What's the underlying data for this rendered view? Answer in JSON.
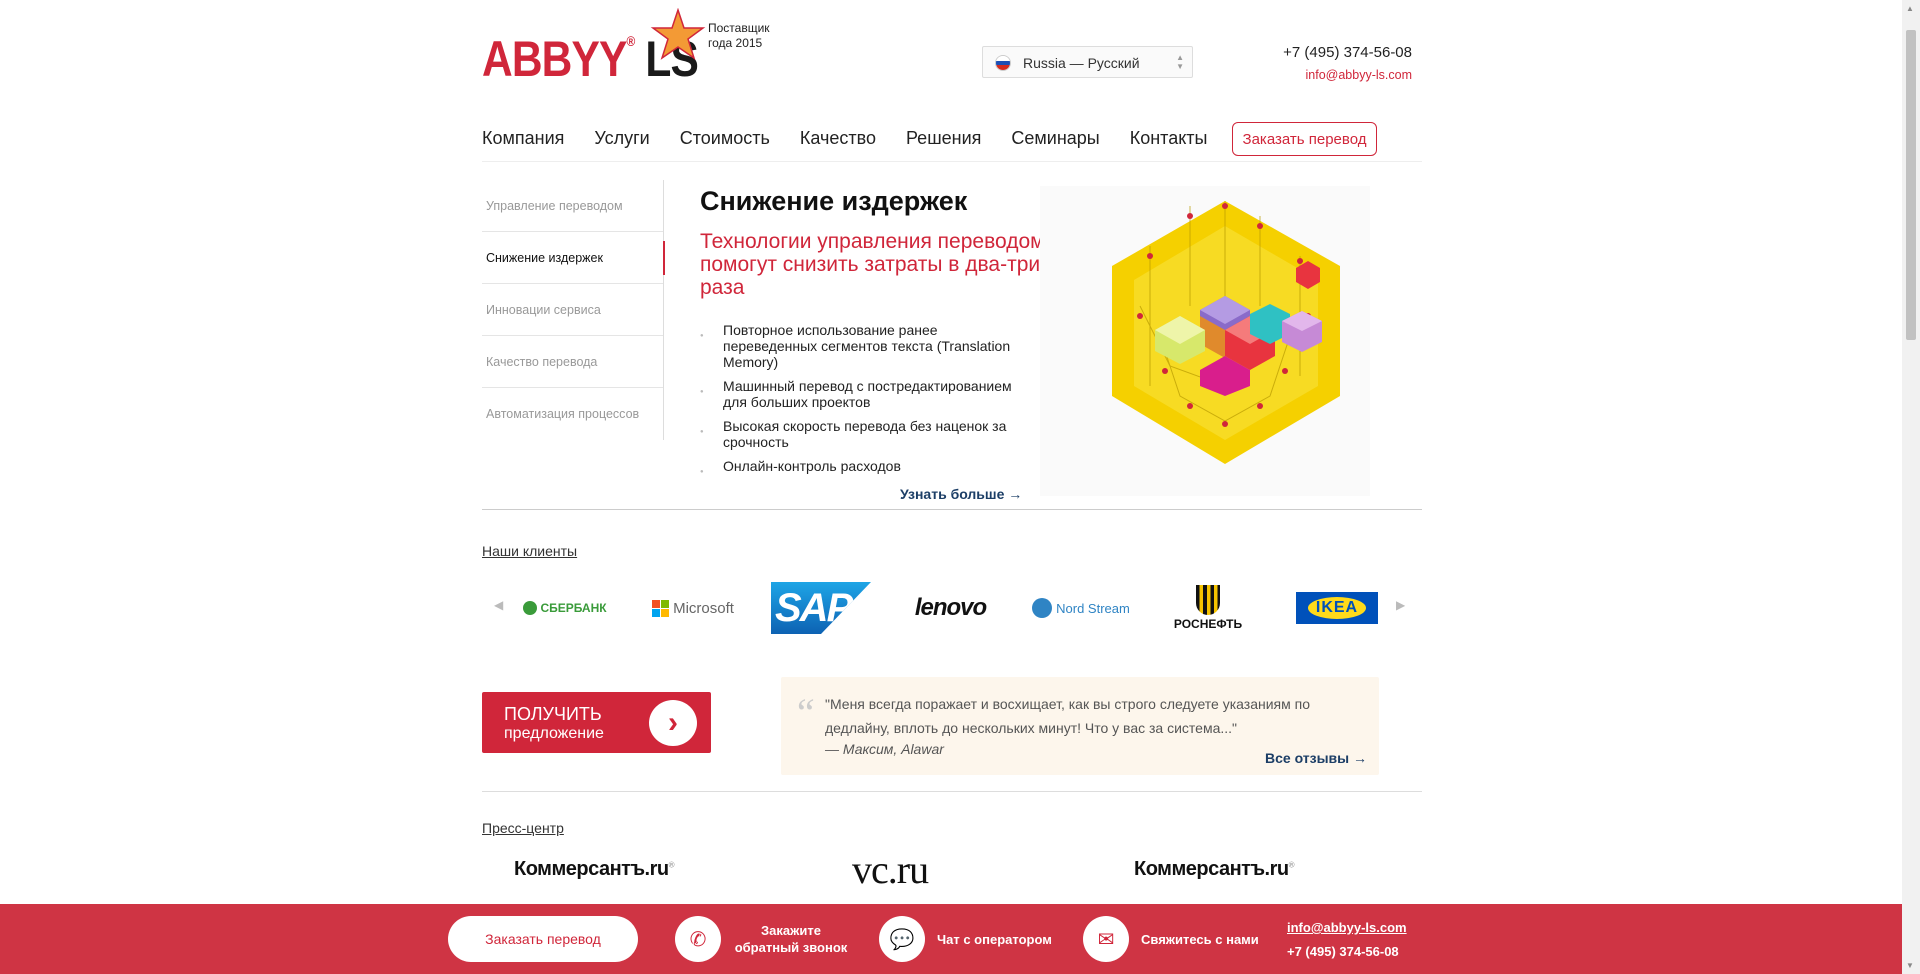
{
  "header": {
    "logo_abbyy": "ABBYY",
    "logo_ls": "LS",
    "award": [
      "Поставщик",
      "года 2015"
    ],
    "language": "Russia — Русский",
    "phone": "+7 (495) 374-56-08",
    "email": "info@abbyy-ls.com"
  },
  "nav": {
    "items": [
      "Компания",
      "Услуги",
      "Стоимость",
      "Качество",
      "Решения",
      "Семинары",
      "Контакты"
    ],
    "order_button": "Заказать перевод"
  },
  "side_menu": {
    "items": [
      "Управление переводом",
      "Снижение издержек",
      "Инновации сервиса",
      "Качество перевода",
      "Автоматизация процессов"
    ],
    "active_index": 1
  },
  "main": {
    "title": "Снижение издержек",
    "subtitle": "Технологии управления переводом помогут снизить затраты в два-три раза",
    "bullets": [
      "Повторное использование ранее переведенных сегментов текста (Translation Memory)",
      "Машинный перевод с постредактированием для больших проектов",
      "Высокая скорость перевода без наценок за срочность",
      "Онлайн-контроль расходов"
    ],
    "more_link": "Узнать больше →"
  },
  "clients": {
    "title": "Наши клиенты",
    "logos": {
      "sber": "СБЕРБАНК",
      "microsoft": "Microsoft",
      "sap": "SAP",
      "lenovo": "lenovo",
      "nordstream": "Nord Stream",
      "rosneft": "РОСНЕФТЬ",
      "ikea": "IKEA"
    }
  },
  "cta": {
    "line1": "ПОЛУЧИТЬ",
    "line2": "предложение"
  },
  "testimonial": {
    "quote": "\"Меня всегда поражает и восхищает, как вы строго следуете указаниям по дедлайну, вплоть до нескольких минут! Что у вас за система...\"",
    "author": "— Максим, Alawar",
    "all_reviews": "Все отзывы →"
  },
  "press": {
    "title": "Пресс-центр",
    "logos": [
      "Коммерсантъ.ru",
      "vc.ru",
      "Коммерсантъ.ru"
    ]
  },
  "footer_bar": {
    "order_button": "Заказать перевод",
    "callback": "Закажите обратный звонок",
    "chat": "Чат с оператором",
    "contact": "Свяжитесь с нами",
    "email": "info@abbyy-ls.com",
    "phone": "+7 (495) 374-56-08"
  },
  "colors": {
    "brand_red": "#d0263a",
    "link_navy": "#1c3e66",
    "hero_yellow": "#f5d000"
  }
}
